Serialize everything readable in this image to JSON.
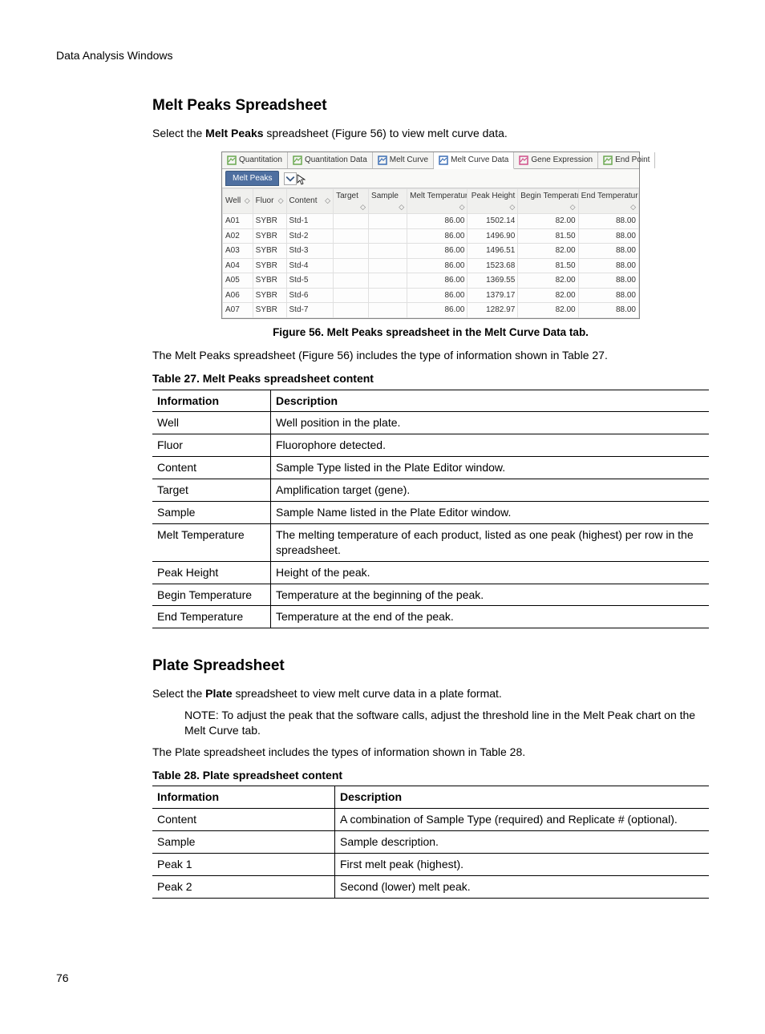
{
  "header": {
    "chapter": "Data Analysis Windows"
  },
  "page_number": "76",
  "section1": {
    "title": "Melt Peaks Spreadsheet",
    "intro_pre": "Select the ",
    "intro_bold": "Melt Peaks",
    "intro_post": " spreadsheet (Figure 56) to view melt curve data.",
    "figure_caption": "Figure 56. Melt Peaks spreadsheet in the Melt Curve Data tab.",
    "after_figure": "The Melt Peaks spreadsheet (Figure 56) includes the type of information shown in Table 27.",
    "table_label": "Table 27.  Melt Peaks spreadsheet content",
    "table_header_info": "Information",
    "table_header_desc": "Description",
    "rows": [
      {
        "info": "Well",
        "desc": "Well position in the plate."
      },
      {
        "info": "Fluor",
        "desc": "Fluorophore detected."
      },
      {
        "info": "Content",
        "desc": "Sample Type listed in the Plate Editor window."
      },
      {
        "info": "Target",
        "desc": "Amplification target (gene)."
      },
      {
        "info": "Sample",
        "desc": "Sample Name listed in the Plate Editor window."
      },
      {
        "info": "Melt Temperature",
        "desc": "The melting temperature of each product, listed as one peak (highest) per row in the spreadsheet."
      },
      {
        "info": "Peak Height",
        "desc": "Height of the peak."
      },
      {
        "info": "Begin Temperature",
        "desc": "Temperature at the beginning of the peak."
      },
      {
        "info": "End Temperature",
        "desc": "Temperature at the end of the peak."
      }
    ]
  },
  "screenshot": {
    "tabs": [
      {
        "label": "Quantitation",
        "color": "#6aa84f"
      },
      {
        "label": "Quantitation Data",
        "color": "#6aa84f"
      },
      {
        "label": "Melt Curve",
        "color": "#3d6fb5"
      },
      {
        "label": "Melt Curve Data",
        "color": "#3d6fb5"
      },
      {
        "label": "Gene Expression",
        "color": "#d04f8a"
      },
      {
        "label": "End Point",
        "color": "#6aa84f"
      }
    ],
    "sub_tab": "Melt Peaks",
    "columns": [
      "Well",
      "Fluor",
      "Content",
      "Target",
      "Sample",
      "Melt Temperature",
      "Peak Height",
      "Begin Temperature",
      "End Temperature"
    ],
    "data": [
      {
        "well": "A01",
        "fluor": "SYBR",
        "content": "Std-1",
        "target": "",
        "sample": "",
        "melt": "86.00",
        "height": "1502.14",
        "begin": "82.00",
        "end": "88.00"
      },
      {
        "well": "A02",
        "fluor": "SYBR",
        "content": "Std-2",
        "target": "",
        "sample": "",
        "melt": "86.00",
        "height": "1496.90",
        "begin": "81.50",
        "end": "88.00"
      },
      {
        "well": "A03",
        "fluor": "SYBR",
        "content": "Std-3",
        "target": "",
        "sample": "",
        "melt": "86.00",
        "height": "1496.51",
        "begin": "82.00",
        "end": "88.00"
      },
      {
        "well": "A04",
        "fluor": "SYBR",
        "content": "Std-4",
        "target": "",
        "sample": "",
        "melt": "86.00",
        "height": "1523.68",
        "begin": "81.50",
        "end": "88.00"
      },
      {
        "well": "A05",
        "fluor": "SYBR",
        "content": "Std-5",
        "target": "",
        "sample": "",
        "melt": "86.00",
        "height": "1369.55",
        "begin": "82.00",
        "end": "88.00"
      },
      {
        "well": "A06",
        "fluor": "SYBR",
        "content": "Std-6",
        "target": "",
        "sample": "",
        "melt": "86.00",
        "height": "1379.17",
        "begin": "82.00",
        "end": "88.00"
      },
      {
        "well": "A07",
        "fluor": "SYBR",
        "content": "Std-7",
        "target": "",
        "sample": "",
        "melt": "86.00",
        "height": "1282.97",
        "begin": "82.00",
        "end": "88.00"
      }
    ]
  },
  "section2": {
    "title": "Plate Spreadsheet",
    "intro_pre": "Select the ",
    "intro_bold": "Plate",
    "intro_post": " spreadsheet to view melt curve data in a plate format.",
    "note": "NOTE: To adjust the peak that the software calls, adjust the threshold line in the Melt Peak chart on the Melt Curve tab.",
    "after_note": "The Plate spreadsheet includes the types of information shown in Table 28.",
    "table_label": "Table 28. Plate spreadsheet content",
    "table_header_info": "Information",
    "table_header_desc": "Description",
    "rows": [
      {
        "info": "Content",
        "desc": "A combination of Sample Type (required) and Replicate # (optional)."
      },
      {
        "info": "Sample",
        "desc": "Sample description."
      },
      {
        "info": "Peak 1",
        "desc": "First melt peak (highest)."
      },
      {
        "info": "Peak 2",
        "desc": "Second (lower) melt peak."
      }
    ]
  }
}
